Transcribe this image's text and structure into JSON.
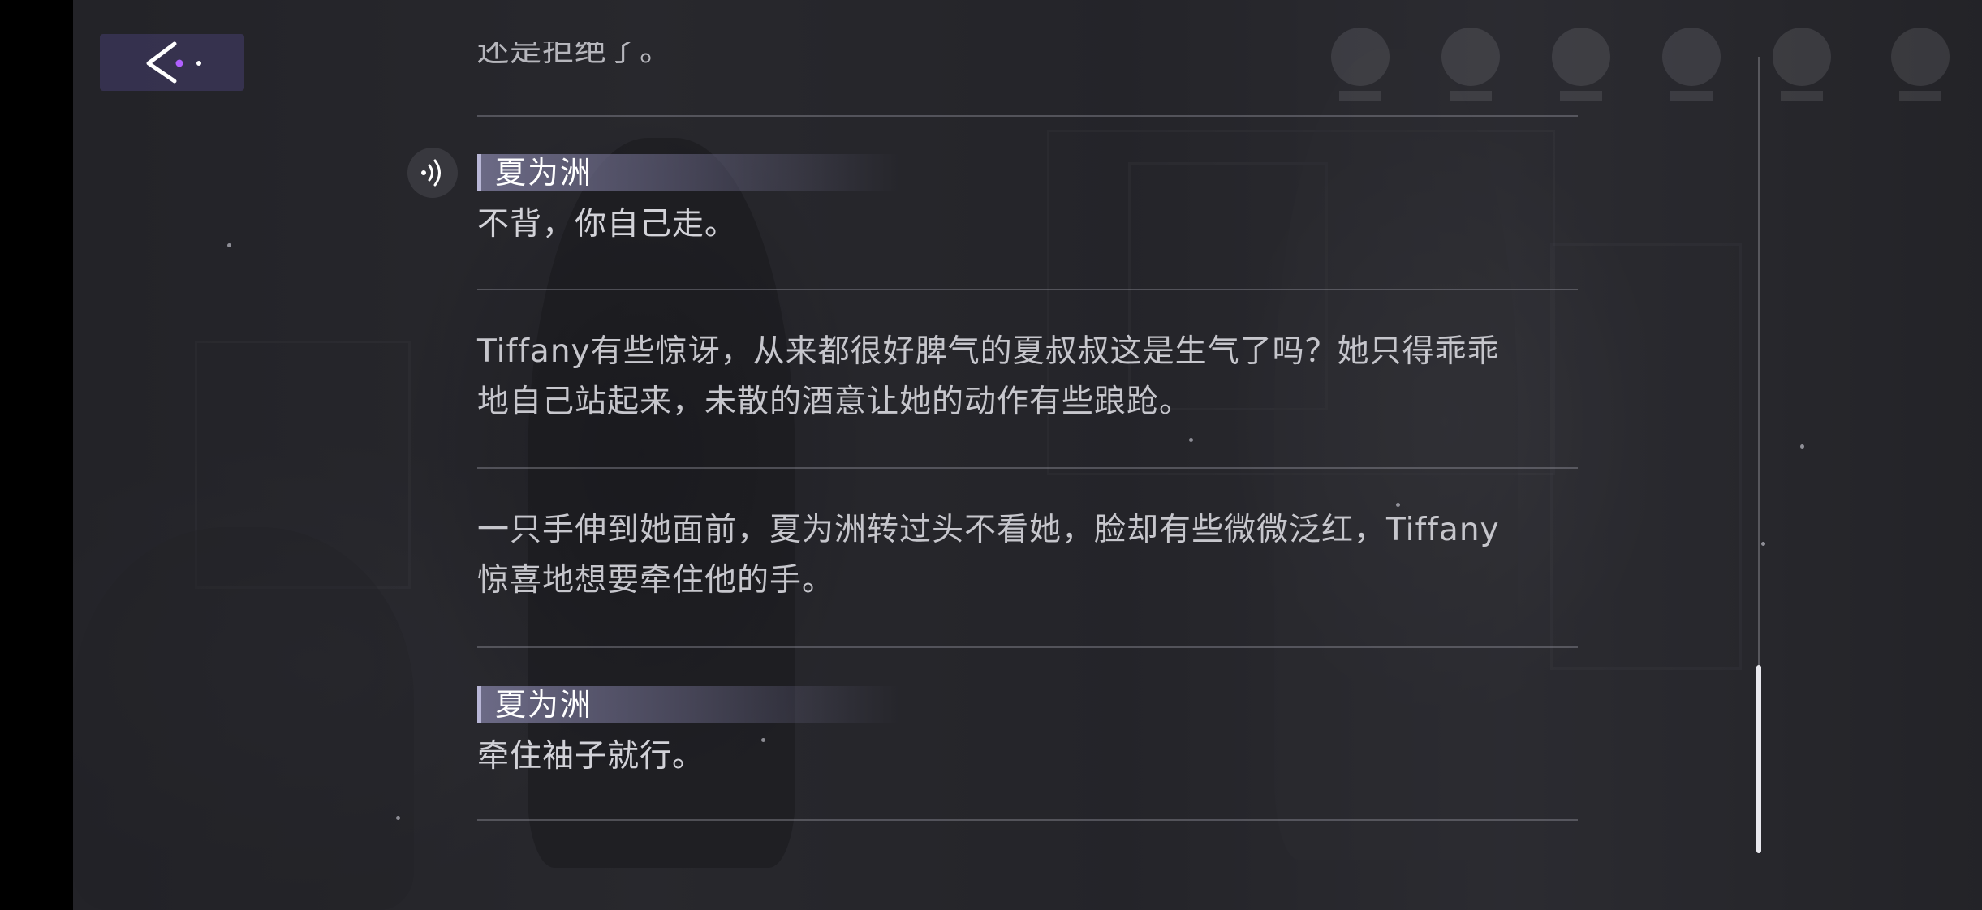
{
  "log": {
    "entries": [
      {
        "type": "narration",
        "text": "还是拒绝了。"
      },
      {
        "type": "dialogue",
        "speaker": "夏为洲",
        "text": "不背，你自己走。",
        "has_voice": true
      },
      {
        "type": "narration",
        "text": "Tiffany有些惊讶，从来都很好脾气的夏叔叔这是生气了吗？她只得乖乖\n地自己站起来，未散的酒意让她的动作有些踉跄。"
      },
      {
        "type": "narration",
        "text": "一只手伸到她面前，夏为洲转过头不看她，脸却有些微微泛红，Tiffany\n惊喜地想要牵住他的手。"
      },
      {
        "type": "dialogue",
        "speaker": "夏为洲",
        "text": "牵住袖子就行。",
        "has_voice": false
      }
    ]
  },
  "icons": {
    "back": "back-arrow-icon",
    "voice": "voice-replay-icon",
    "controls": [
      "auto-play-icon",
      "hide-ui-icon",
      "log-icon",
      "skip-icon",
      "pause-icon",
      "close-icon"
    ]
  },
  "colors": {
    "back_button_bg": "#463e6e",
    "speaker_tag": "#7876a0",
    "accent_dot": "#b060ff"
  }
}
